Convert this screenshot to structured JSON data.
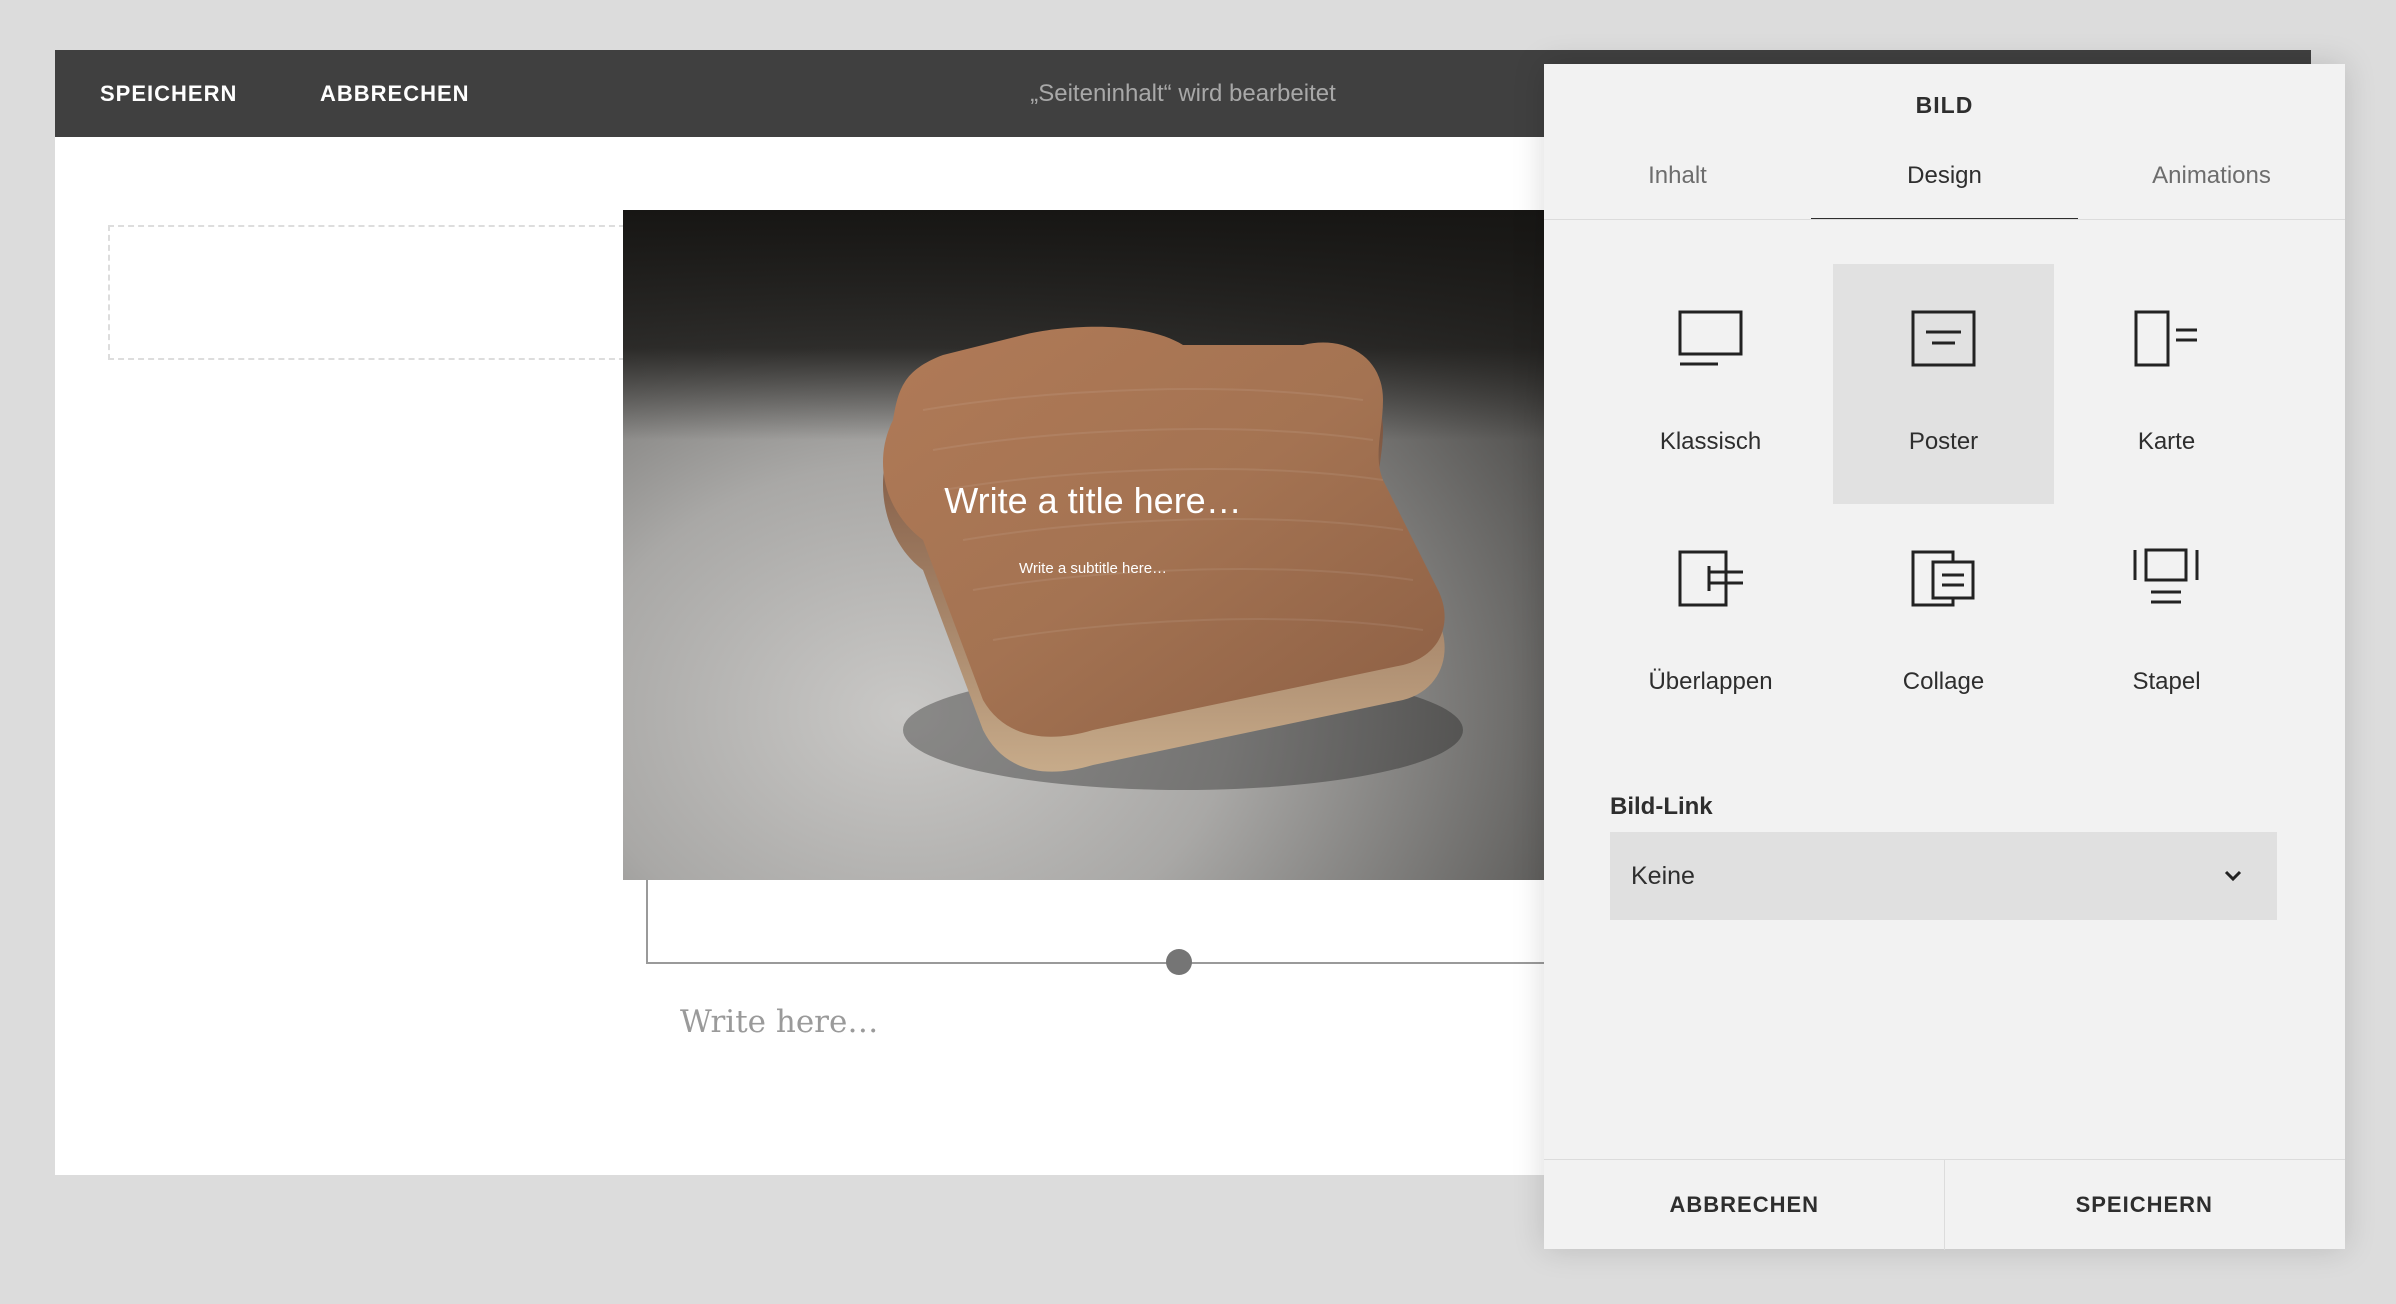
{
  "toolbar": {
    "save_label": "SPEICHERN",
    "cancel_label": "ABBRECHEN",
    "editing_title": "„Seiteninhalt“ wird bearbeitet"
  },
  "image_block": {
    "title_placeholder": "Write a title here…",
    "subtitle_placeholder": "Write a subtitle here…"
  },
  "text_block": {
    "placeholder": "Write here…"
  },
  "panel": {
    "title": "BILD",
    "tabs": [
      {
        "label": "Inhalt",
        "active": false
      },
      {
        "label": "Design",
        "active": true
      },
      {
        "label": "Animations",
        "active": false
      }
    ],
    "layouts": [
      {
        "label": "Klassisch",
        "icon": "classic-layout-icon",
        "selected": false
      },
      {
        "label": "Poster",
        "icon": "poster-layout-icon",
        "selected": true
      },
      {
        "label": "Karte",
        "icon": "card-layout-icon",
        "selected": false
      },
      {
        "label": "Überlappen",
        "icon": "overlap-layout-icon",
        "selected": false
      },
      {
        "label": "Collage",
        "icon": "collage-layout-icon",
        "selected": false
      },
      {
        "label": "Stapel",
        "icon": "stack-layout-icon",
        "selected": false
      }
    ],
    "link_label": "Bild-Link",
    "link_value": "Keine",
    "footer": {
      "cancel_label": "ABBRECHEN",
      "save_label": "SPEICHERN"
    }
  }
}
